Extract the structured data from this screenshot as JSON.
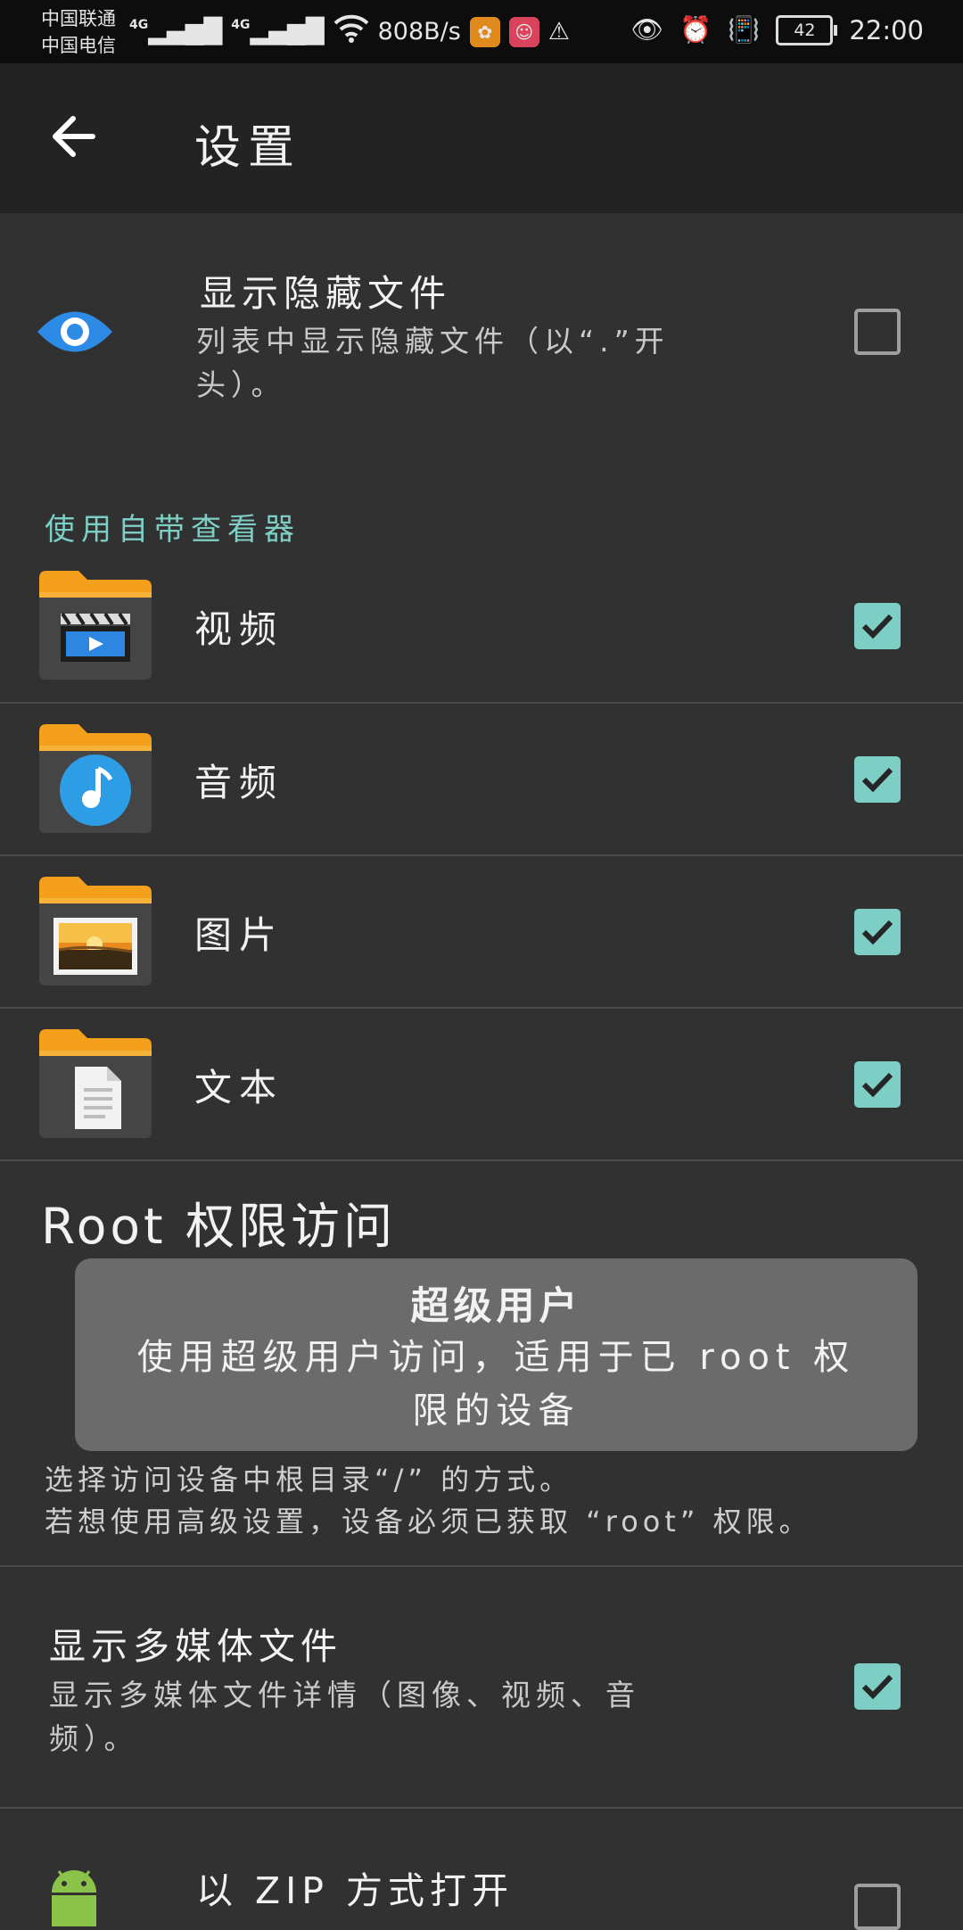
{
  "status_bar": {
    "carrier_1": "中国联通",
    "carrier_2": "中国电信",
    "net_1": "4G",
    "net_2": "4G",
    "speed": "808B/s",
    "battery": "42",
    "time": "22:00"
  },
  "header": {
    "title": "设置"
  },
  "hidden_files": {
    "title": "显示隐藏文件",
    "summary_line1": "列表中显示隐藏文件（以“.”开",
    "summary_line2": "头）。",
    "checked": false
  },
  "viewer_section": {
    "header": "使用自带查看器",
    "items": [
      {
        "label": "视频",
        "icon": "video-folder-icon",
        "checked": true
      },
      {
        "label": "音频",
        "icon": "audio-folder-icon",
        "checked": true
      },
      {
        "label": "图片",
        "icon": "image-folder-icon",
        "checked": true
      },
      {
        "label": "文本",
        "icon": "text-folder-icon",
        "checked": true
      }
    ]
  },
  "root_section": {
    "title": "Root 权限访问",
    "toast_title": "超级用户",
    "toast_body_line1": "使用超级用户访问，适用于已 root 权",
    "toast_body_line2": "限的设备",
    "desc_line1": "选择访问设备中根目录“/” 的方式。",
    "desc_line2": "若想使用高级设置，设备必须已获取 “root” 权限。"
  },
  "media_files": {
    "title": "显示多媒体文件",
    "summary_line1": "显示多媒体文件详情（图像、视频、音",
    "summary_line2": "频）。",
    "checked": true
  },
  "zip": {
    "title": "以 ZIP 方式打开",
    "checked": false
  },
  "colors": {
    "accent": "#7dcfc5",
    "background": "#313131",
    "appbar": "#232323",
    "status_bar": "#0d0d0d"
  }
}
